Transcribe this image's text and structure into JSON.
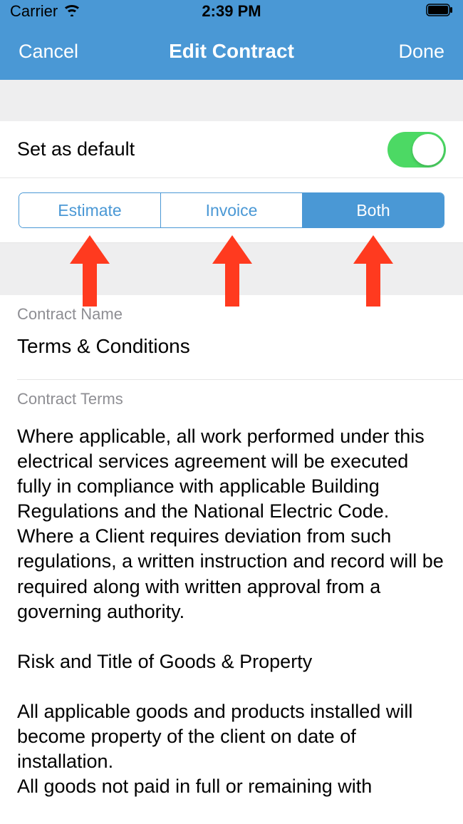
{
  "status": {
    "carrier": "Carrier",
    "time": "2:39 PM"
  },
  "nav": {
    "cancel": "Cancel",
    "title": "Edit Contract",
    "done": "Done"
  },
  "defaultRow": {
    "label": "Set as default",
    "on": true
  },
  "segments": {
    "estimate": "Estimate",
    "invoice": "Invoice",
    "both": "Both"
  },
  "contractName": {
    "label": "Contract Name",
    "value": "Terms & Conditions"
  },
  "contractTerms": {
    "label": "Contract Terms",
    "para1": "Where applicable, all work performed under this electrical services agreement will be executed fully in compliance with applicable Building Regulations and the National Electric Code. Where a Client requires deviation from such regulations, a written instruction and record will be required along with written approval from a governing authority.",
    "heading2": "Risk and Title of Goods & Property",
    "para2": "All applicable goods and products installed will become property of the client on date of installation.",
    "para3partial": "All goods not paid in full or remaining with"
  }
}
